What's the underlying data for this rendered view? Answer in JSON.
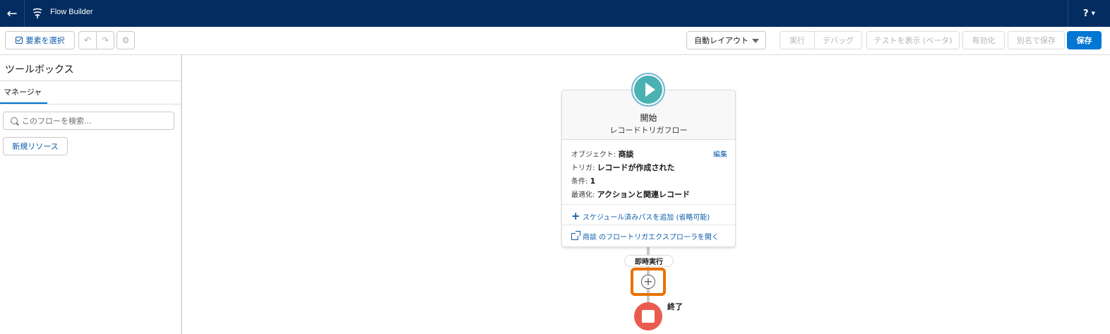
{
  "header": {
    "back_icon": "arrow-left-icon",
    "app_title": "Flow Builder",
    "help_label": "?",
    "brand_color": "#032d60"
  },
  "toolbar": {
    "select_elements_label": "要素を選択",
    "layout_select_value": "自動レイアウト",
    "run_label": "実行",
    "debug_label": "デバッグ",
    "test_label": "テストを表示 (ベータ)",
    "activate_label": "有効化",
    "save_as_label": "別名で保存",
    "save_label": "保存",
    "accent_color": "#0176d3"
  },
  "toolbox": {
    "title": "ツールボックス",
    "tab_label": "マネージャ",
    "search_placeholder": "このフローを検索...",
    "new_resource_label": "新規リソース"
  },
  "start_node": {
    "title": "開始",
    "subtitle": "レコードトリガフロー",
    "edit_label": "編集",
    "rows": [
      {
        "label": "オブジェクト:",
        "value": "商談"
      },
      {
        "label": "トリガ:",
        "value": "レコードが作成された"
      },
      {
        "label": "条件:",
        "value": "1"
      },
      {
        "label": "最適化:",
        "value": "アクションと関連レコード"
      }
    ],
    "add_path_label": "スケジュール済みパスを追加 (省略可能)",
    "explorer_label": "商談 のフロートリガエクスプローラを開く"
  },
  "flow": {
    "immediate_label": "即時実行",
    "end_label": "終了",
    "add_icon": "plus-circle-icon",
    "end_color": "#ea5b4f",
    "start_color": "#4bb1b2",
    "highlight_color": "#ea7200"
  }
}
